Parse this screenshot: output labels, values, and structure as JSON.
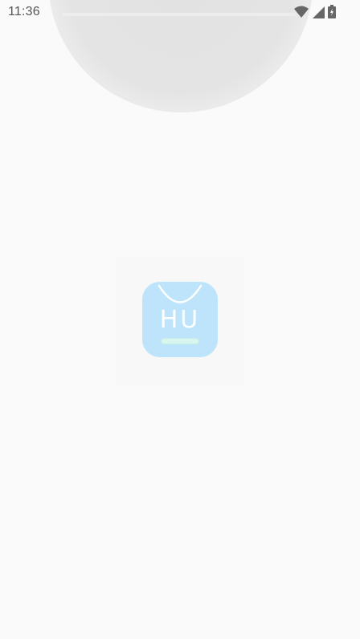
{
  "status_bar": {
    "time": "11:36",
    "icons": [
      "wifi-icon",
      "cell-signal-icon",
      "battery-icon"
    ]
  },
  "splash": {
    "logo_text": "HU",
    "logo_color": "#bde4fb",
    "background_color": "#fafafa"
  }
}
